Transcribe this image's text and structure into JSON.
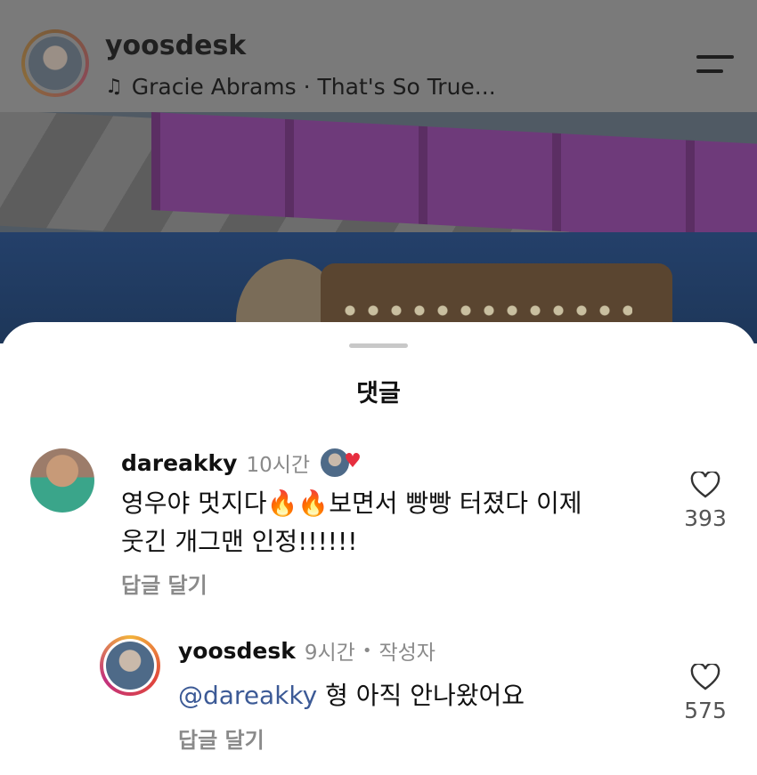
{
  "header": {
    "username": "yoosdesk",
    "music_icon": "music-note-icon",
    "music_text": "Gracie Abrams · That's So True...",
    "menu_icon": "menu-icon"
  },
  "comments_sheet": {
    "title": "댓글",
    "comments": [
      {
        "username": "dareakky",
        "time": "10시간",
        "liked_by_author": true,
        "text_line1": "영우야 멋지다🔥🔥보면서 빵빵 터졌다 이제",
        "text_line2": "웃긴 개그맨 인정!!!!!!",
        "reply_label": "답글 달기",
        "likes": "393"
      },
      {
        "username": "yoosdesk",
        "time": "9시간",
        "separator": "•",
        "author_badge": "작성자",
        "mention": "@dareakky",
        "text": " 형 아직 안나왔어요",
        "reply_label": "답글 달기",
        "likes": "575"
      }
    ]
  },
  "colors": {
    "mention": "#3c5a96",
    "heart": "#e62e3f",
    "muted": "#8a8a8a"
  }
}
